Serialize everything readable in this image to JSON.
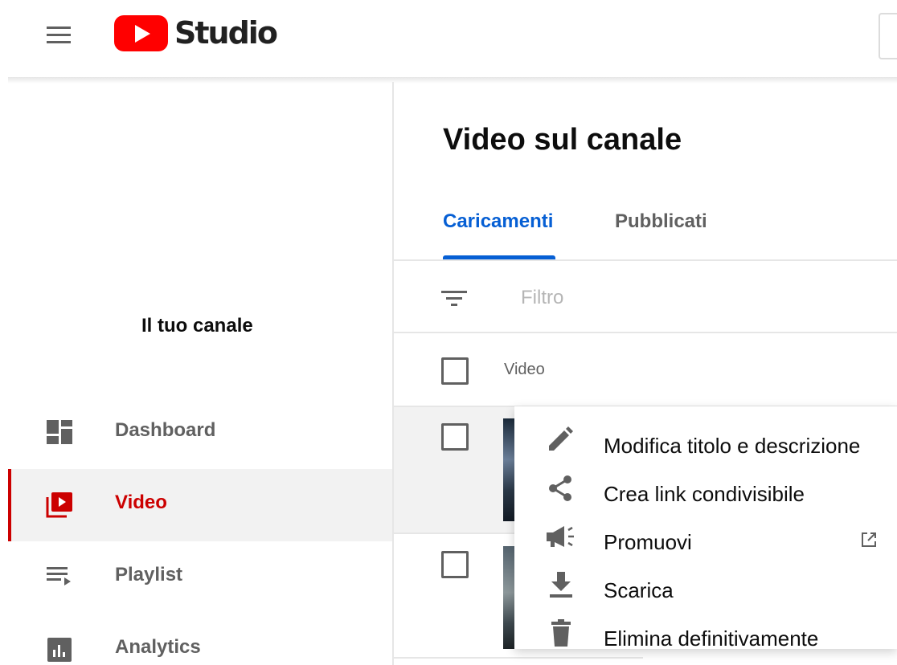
{
  "app": {
    "logo_text": "Studio",
    "brand_color": "#ff0000",
    "accent_color": "#065fd4",
    "active_color": "#cc0000"
  },
  "sidebar": {
    "channel_label": "Il tuo canale",
    "items": [
      {
        "label": "Dashboard",
        "icon": "dashboard-icon",
        "active": false
      },
      {
        "label": "Video",
        "icon": "video-library-icon",
        "active": true
      },
      {
        "label": "Playlist",
        "icon": "playlist-icon",
        "active": false
      },
      {
        "label": "Analytics",
        "icon": "analytics-icon",
        "active": false
      }
    ]
  },
  "main": {
    "title": "Video sul canale",
    "tabs": [
      {
        "label": "Caricamenti",
        "active": true
      },
      {
        "label": "Pubblicati",
        "active": false
      }
    ],
    "filter": {
      "placeholder": "Filtro",
      "value": ""
    },
    "table": {
      "columns": [
        "Video"
      ]
    }
  },
  "context_menu": {
    "items": [
      {
        "label": "Modifica titolo e descrizione",
        "icon": "pencil-icon"
      },
      {
        "label": "Crea link condivisibile",
        "icon": "share-icon"
      },
      {
        "label": "Promuovi",
        "icon": "megaphone-icon",
        "external": true
      },
      {
        "label": "Scarica",
        "icon": "download-icon"
      },
      {
        "label": "Elimina definitivamente",
        "icon": "trash-icon"
      }
    ]
  }
}
